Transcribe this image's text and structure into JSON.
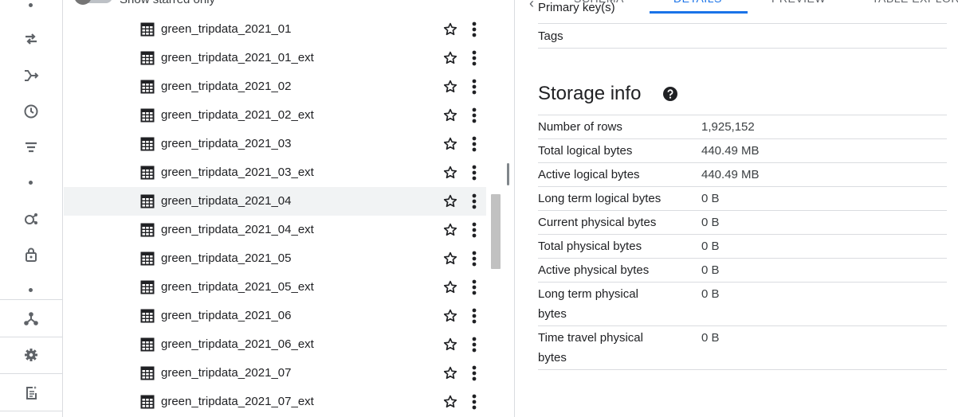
{
  "rail": {
    "icons": [
      "transfer-icon",
      "scheduled-query-icon",
      "history-icon",
      "filter-list-icon",
      "analytics-hub-icon",
      "lock-icon",
      "hub-icon",
      "gear-icon",
      "release-notes-icon"
    ]
  },
  "explorer": {
    "starred_label": "Show starred only",
    "items": [
      {
        "label": "green_tripdata_2021_01"
      },
      {
        "label": "green_tripdata_2021_01_ext"
      },
      {
        "label": "green_tripdata_2021_02"
      },
      {
        "label": "green_tripdata_2021_02_ext"
      },
      {
        "label": "green_tripdata_2021_03"
      },
      {
        "label": "green_tripdata_2021_03_ext"
      },
      {
        "label": "green_tripdata_2021_04",
        "selected": true
      },
      {
        "label": "green_tripdata_2021_04_ext"
      },
      {
        "label": "green_tripdata_2021_05"
      },
      {
        "label": "green_tripdata_2021_05_ext"
      },
      {
        "label": "green_tripdata_2021_06"
      },
      {
        "label": "green_tripdata_2021_06_ext"
      },
      {
        "label": "green_tripdata_2021_07"
      },
      {
        "label": "green_tripdata_2021_07_ext"
      }
    ]
  },
  "details": {
    "tabs": [
      "SCHEMA",
      "DETAILS",
      "PREVIEW",
      "TABLE EXPLORER"
    ],
    "active_tab": "DETAILS",
    "accent_color": "#1a73e8",
    "schema_rows": [
      {
        "key": "Primary key(s)",
        "value": ""
      },
      {
        "key": "Tags",
        "value": ""
      }
    ],
    "storage_title": "Storage info",
    "storage_rows": [
      {
        "key": "Number of rows",
        "value": "1,925,152"
      },
      {
        "key": "Total logical bytes",
        "value": "440.49 MB"
      },
      {
        "key": "Active logical bytes",
        "value": "440.49 MB"
      },
      {
        "key": "Long term logical bytes",
        "value": "0 B"
      },
      {
        "key": "Current physical bytes",
        "value": "0 B"
      },
      {
        "key": "Total physical bytes",
        "value": "0 B"
      },
      {
        "key": "Active physical bytes",
        "value": "0 B"
      },
      {
        "key": "Long term physical bytes",
        "value": "0 B"
      },
      {
        "key": "Time travel physical bytes",
        "value": "0 B"
      }
    ]
  }
}
